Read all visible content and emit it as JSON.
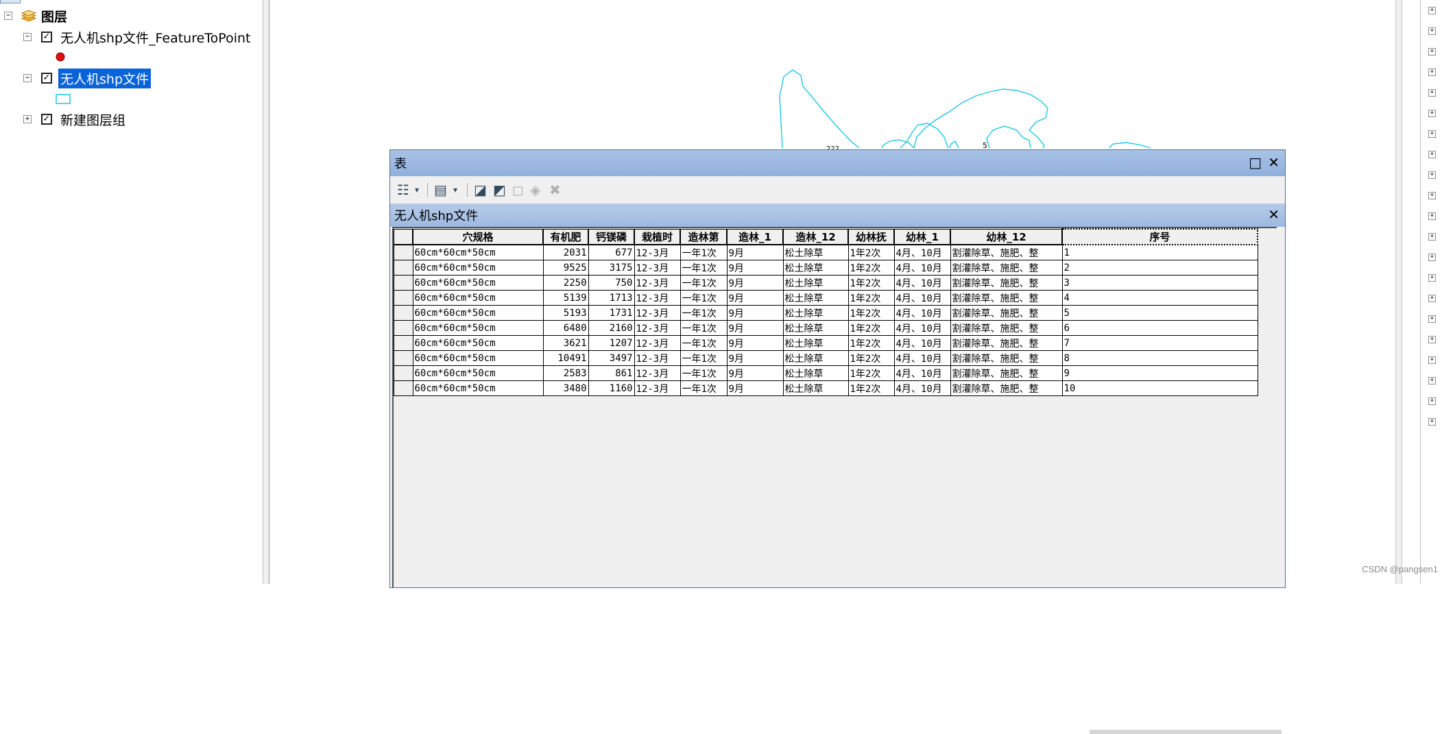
{
  "toc": {
    "root_label": "图层",
    "layers": [
      {
        "label": "无人机shp文件_FeatureToPoint",
        "checked": true,
        "expanded": true,
        "symbol": "red-point"
      },
      {
        "label": "无人机shp文件",
        "checked": true,
        "expanded": true,
        "selected": true,
        "symbol": "cyan-polygon"
      },
      {
        "label": "新建图层组",
        "checked": true,
        "expanded": false
      }
    ]
  },
  "map": {
    "feature_color": "#1ec6e6",
    "labels": [
      "5",
      "222"
    ]
  },
  "table_window": {
    "title": "表",
    "tab_title": "无人机shp文件",
    "toolbar_icons": [
      "table-options-icon",
      "related-tables-icon",
      "select-by-attributes-icon",
      "switch-selection-icon",
      "clear-selection-icon",
      "zoom-to-selected-icon",
      "delete-selected-icon"
    ],
    "columns": [
      "穴规格",
      "有机肥",
      "钙镁磷",
      "栽植时",
      "造林第",
      "造林_1",
      "造林_12",
      "幼林抚",
      "幼林_1",
      "幼林_12",
      "序号"
    ],
    "rows": [
      [
        "60cm*60cm*50cm",
        "2031",
        "677",
        "12-3月",
        "一年1次",
        "9月",
        "松土除草",
        "1年2次",
        "4月、10月",
        "割灌除草、施肥、整",
        "1"
      ],
      [
        "60cm*60cm*50cm",
        "9525",
        "3175",
        "12-3月",
        "一年1次",
        "9月",
        "松土除草",
        "1年2次",
        "4月、10月",
        "割灌除草、施肥、整",
        "2"
      ],
      [
        "60cm*60cm*50cm",
        "2250",
        "750",
        "12-3月",
        "一年1次",
        "9月",
        "松土除草",
        "1年2次",
        "4月、10月",
        "割灌除草、施肥、整",
        "3"
      ],
      [
        "60cm*60cm*50cm",
        "5139",
        "1713",
        "12-3月",
        "一年1次",
        "9月",
        "松土除草",
        "1年2次",
        "4月、10月",
        "割灌除草、施肥、整",
        "4"
      ],
      [
        "60cm*60cm*50cm",
        "5193",
        "1731",
        "12-3月",
        "一年1次",
        "9月",
        "松土除草",
        "1年2次",
        "4月、10月",
        "割灌除草、施肥、整",
        "5"
      ],
      [
        "60cm*60cm*50cm",
        "6480",
        "2160",
        "12-3月",
        "一年1次",
        "9月",
        "松土除草",
        "1年2次",
        "4月、10月",
        "割灌除草、施肥、整",
        "6"
      ],
      [
        "60cm*60cm*50cm",
        "3621",
        "1207",
        "12-3月",
        "一年1次",
        "9月",
        "松土除草",
        "1年2次",
        "4月、10月",
        "割灌除草、施肥、整",
        "7"
      ],
      [
        "60cm*60cm*50cm",
        "10491",
        "3497",
        "12-3月",
        "一年1次",
        "9月",
        "松土除草",
        "1年2次",
        "4月、10月",
        "割灌除草、施肥、整",
        "8"
      ],
      [
        "60cm*60cm*50cm",
        "2583",
        "861",
        "12-3月",
        "一年1次",
        "9月",
        "松土除草",
        "1年2次",
        "4月、10月",
        "割灌除草、施肥、整",
        "9"
      ],
      [
        "60cm*60cm*50cm",
        "3480",
        "1160",
        "12-3月",
        "一年1次",
        "9月",
        "松土除草",
        "1年2次",
        "4月、10月",
        "割灌除草、施肥、整",
        "10"
      ]
    ]
  },
  "watermark": "CSDN @pangsen1"
}
